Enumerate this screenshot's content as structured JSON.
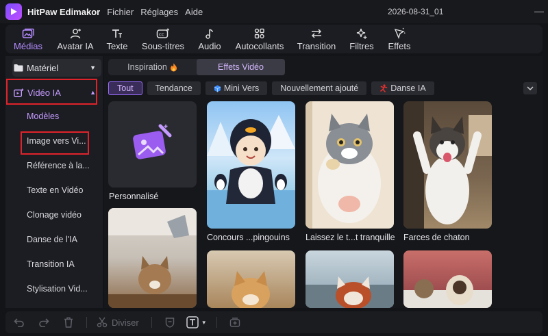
{
  "titlebar": {
    "app_name": "HitPaw Edimakor",
    "menu": [
      "Fichier",
      "Réglages",
      "Aide"
    ],
    "project": "2026-08-31_01",
    "logo_icon": "edimakor-logo-icon"
  },
  "tooltabs": [
    {
      "label": "Médias",
      "icon": "media-icon",
      "active": true
    },
    {
      "label": "Avatar IA",
      "icon": "avatar-icon"
    },
    {
      "label": "Texte",
      "icon": "text-icon"
    },
    {
      "label": "Sous-titres",
      "icon": "subtitles-icon"
    },
    {
      "label": "Audio",
      "icon": "music-note-icon"
    },
    {
      "label": "Autocollants",
      "icon": "stickers-icon"
    },
    {
      "label": "Transition",
      "icon": "transition-icon"
    },
    {
      "label": "Filtres",
      "icon": "sparkle-icon"
    },
    {
      "label": "Effets",
      "icon": "effects-icon"
    }
  ],
  "sidebar": {
    "material_label": "Matériel",
    "video_ai_label": "Vidéo IA",
    "items": [
      "Modèles",
      "Image vers Vi...",
      "Référence à la...",
      "Texte en Vidéo",
      "Clonage vidéo",
      "Danse de l'IA",
      "Transition IA",
      "Stylisation Vid..."
    ]
  },
  "main": {
    "segment": [
      "Inspiration",
      "Effets Vidéo"
    ],
    "segment_active": "Effets Vidéo",
    "chips": [
      "Tout",
      "Tendance",
      "Mini Vers",
      "Nouvellement ajouté",
      "Danse IA"
    ],
    "chip_active": "Tout",
    "cards": [
      "Personnalisé",
      "Concours ...pingouins",
      "Laissez le t...t tranquille",
      "Farces de chaton"
    ]
  },
  "bottombar": {
    "split_label": "Diviser"
  },
  "colors": {
    "accent": "#b48cff",
    "highlight_box": "#e0232b",
    "background": "#131418"
  }
}
